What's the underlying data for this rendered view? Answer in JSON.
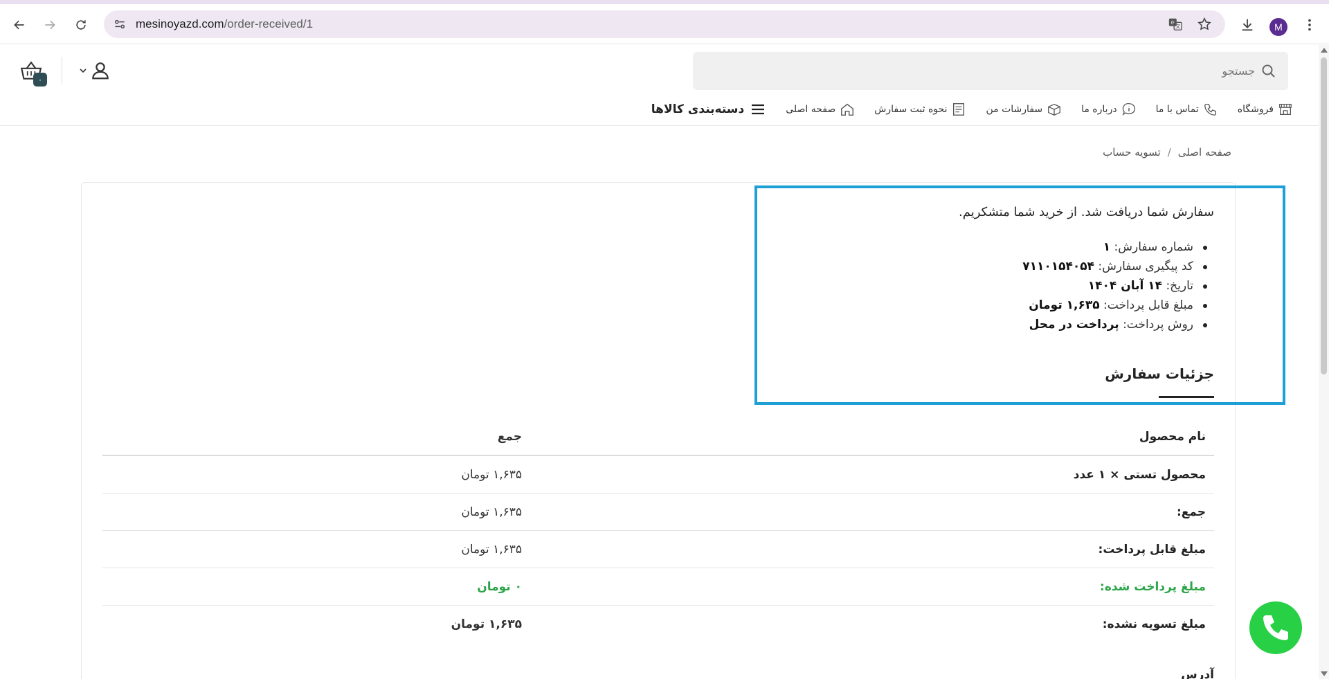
{
  "browser": {
    "url_domain": "mesinoyazd.com",
    "url_path": "/order-received/1",
    "profile_initial": "M"
  },
  "header": {
    "search_placeholder": "جستجو",
    "cart_count": "۰"
  },
  "nav": {
    "categories": "دسته‌بندی کالاها",
    "items": [
      "صفحه اصلی",
      "نحوه ثبت سفارش",
      "سفارشات من",
      "درباره ما",
      "تماس با ما",
      "فروشگاه"
    ]
  },
  "breadcrumb": {
    "home": "صفحه اصلی",
    "separator": "/",
    "current": "تسویه حساب"
  },
  "order": {
    "thanks": "سفارش شما دریافت شد. از خرید شما متشکریم.",
    "info": [
      {
        "label": "شماره سفارش:",
        "value": "۱"
      },
      {
        "label": "کد پیگیری سفارش:",
        "value": "۷۱۱۰۱۵۴۰۵۴"
      },
      {
        "label": "تاریخ:",
        "value": "۱۴ آبان ۱۴۰۴"
      },
      {
        "label": "مبلغ قابل پرداخت:",
        "value": "۱,۶۳۵ تومان"
      },
      {
        "label": "روش پرداخت:",
        "value": "پرداخت در محل"
      }
    ],
    "details_title": "جزئیات سفارش"
  },
  "table": {
    "head": {
      "product": "نام محصول",
      "total": "جمع"
    },
    "rows": [
      {
        "label": "محصول تستی × ۱ عدد",
        "value": "۱,۶۳۵ تومان"
      },
      {
        "label": "جمع:",
        "value": "۱,۶۳۵ تومان"
      },
      {
        "label": "مبلغ قابل پرداخت:",
        "value": "۱,۶۳۵ تومان"
      },
      {
        "label": "مبلغ پرداخت شده:",
        "value": "۰ تومان"
      },
      {
        "label": "مبلغ تسویه نشده:",
        "value": "۱,۶۳۵ تومان"
      }
    ],
    "below_text": "آدرس"
  },
  "colors": {
    "highlight": "#1e9fd5",
    "paid_green": "#2ea54a",
    "whatsapp": "#27d045",
    "badge": "#2f4d55"
  }
}
